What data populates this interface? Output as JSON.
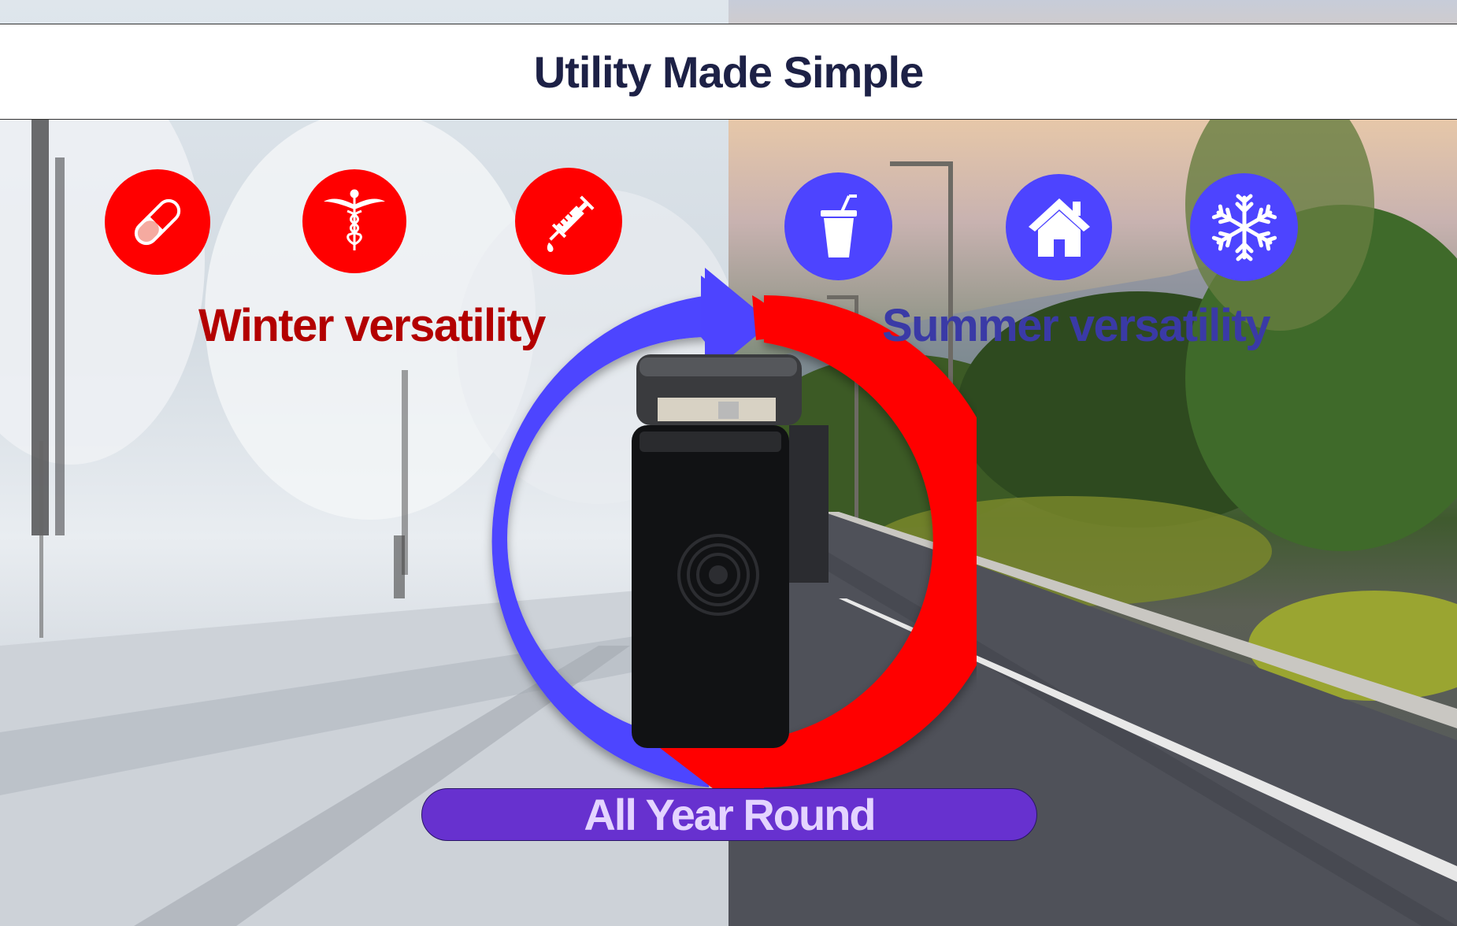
{
  "header": {
    "title": "Utility Made Simple"
  },
  "winter": {
    "label": "Winter versatility",
    "label_color": "#b30000",
    "icons": [
      "pill-icon",
      "caduceus-icon",
      "syringe-icon"
    ],
    "icon_color": "#ff0000"
  },
  "summer": {
    "label": "Summer versatility",
    "label_color": "#3a3aa6",
    "icons": [
      "drink-cup-icon",
      "house-icon",
      "snowflake-icon"
    ],
    "icon_color": "#4d44ff"
  },
  "cycle": {
    "blue_arrow_color": "#4d44ff",
    "red_arrow_color": "#ff0000"
  },
  "product": {
    "name": "portable-cooler-image"
  },
  "footer": {
    "pill_label": "All Year Round",
    "pill_color": "#6731cf"
  }
}
